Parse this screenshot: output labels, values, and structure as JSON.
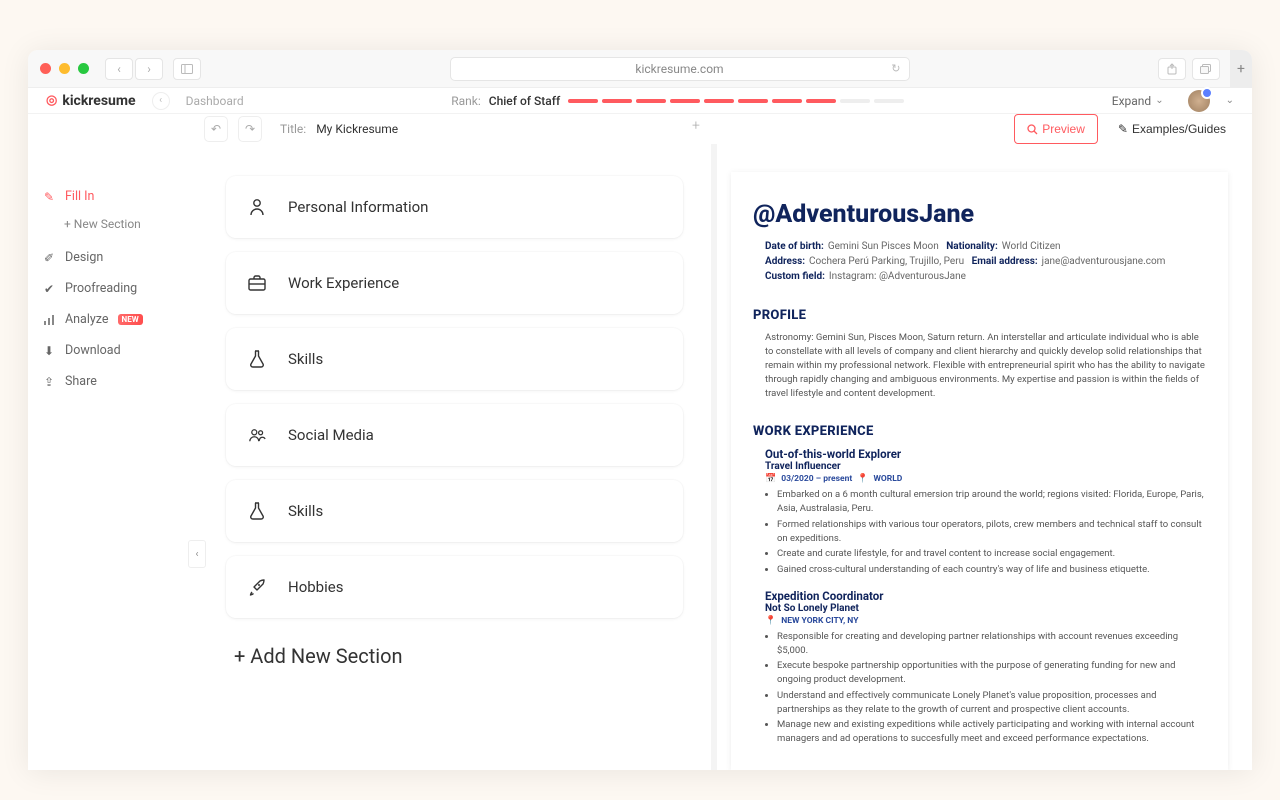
{
  "browser": {
    "url": "kickresume.com"
  },
  "header": {
    "logo": "kickresume",
    "breadcrumb": "Dashboard",
    "rank_label": "Rank:",
    "rank_value": "Chief of Staff",
    "expand": "Expand"
  },
  "subheader": {
    "title_label": "Title:",
    "title_value": "My Kickresume",
    "preview": "Preview",
    "examples": "Examples/Guides"
  },
  "leftnav": {
    "fill_in": "Fill In",
    "new_section": "+ New Section",
    "design": "Design",
    "proofreading": "Proofreading",
    "analyze": "Analyze",
    "analyze_badge": "NEW",
    "download": "Download",
    "share": "Share"
  },
  "sections": [
    {
      "label": "Personal Information",
      "icon": "person"
    },
    {
      "label": "Work Experience",
      "icon": "briefcase"
    },
    {
      "label": "Skills",
      "icon": "flask"
    },
    {
      "label": "Social Media",
      "icon": "people"
    },
    {
      "label": "Skills",
      "icon": "flask"
    },
    {
      "label": "Hobbies",
      "icon": "rocket"
    }
  ],
  "add_section": "+ Add New Section",
  "resume": {
    "name": "@AdventurousJane",
    "meta": {
      "dob_l": "Date of birth:",
      "dob_v": "Gemini Sun Pisces Moon",
      "nat_l": "Nationality:",
      "nat_v": "World Citizen",
      "addr_l": "Address:",
      "addr_v": "Cochera Perú Parking, Trujillo, Peru",
      "email_l": "Email address:",
      "email_v": "jane@adventurousjane.com",
      "cust_l": "Custom field:",
      "cust_v": "Instagram: @AdventurousJane"
    },
    "profile_h": "PROFILE",
    "profile_t": "Astronomy: Gemini Sun, Pisces Moon, Saturn return. An interstellar and articulate individual who is able to constellate with all levels of company and client hierarchy and quickly develop solid relationships that remain within my professional network. Flexible with entrepreneurial spirit who has the ability to navigate through rapidly changing and ambiguous environments. My expertise and passion is within the fields of travel lifestyle and content development.",
    "work_h": "WORK EXPERIENCE",
    "jobs": [
      {
        "title": "Out-of-this-world Explorer",
        "subtitle": "Travel Influencer",
        "date": "03/2020 – present",
        "loc": "WORLD",
        "bullets": [
          "Embarked on a 6 month cultural emersion trip around the world; regions visited: Florida, Europe, Paris, Asia, Australasia, Peru.",
          "Formed relationships with various tour operators, pilots, crew members and technical staff to consult on expeditions.",
          "Create and curate lifestyle, for and travel content to increase social engagement.",
          "Gained cross-cultural understanding of each country's way of life and business etiquette."
        ]
      },
      {
        "title": "Expedition Coordinator",
        "subtitle": "Not So Lonely Planet",
        "loc": "NEW YORK CITY, NY",
        "bullets": [
          "Responsible for creating and developing partner relationships with account revenues exceeding $5,000.",
          "Execute bespoke partnership opportunities with the purpose of generating funding for new and ongoing product development.",
          "Understand and effectively communicate Lonely Planet's value proposition, processes and partnerships as they relate to the growth of current and prospective client accounts.",
          "Manage new and existing expeditions while actively participating and working with internal account managers and ad operations to succesfully meet and exceed performance expectations."
        ]
      }
    ]
  }
}
